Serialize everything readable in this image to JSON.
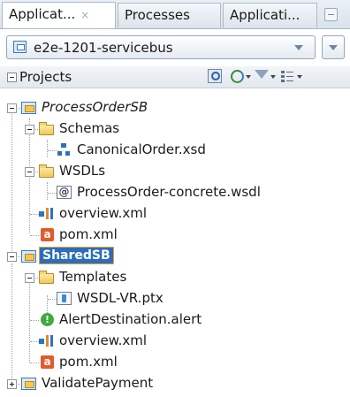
{
  "tabs": [
    {
      "label": "Applicat...",
      "close": "×",
      "active": true
    },
    {
      "label": "Processes",
      "active": false
    },
    {
      "label": "Applicati...",
      "active": false
    }
  ],
  "app_selector": {
    "value": "e2e-1201-servicebus"
  },
  "panel": {
    "title": "Projects"
  },
  "tree": {
    "process_order_sb": "ProcessOrderSB",
    "schemas": "Schemas",
    "canonical_order": "CanonicalOrder.xsd",
    "wsdls": "WSDLs",
    "process_order_wsdl": "ProcessOrder-concrete.wsdl",
    "overview_1": "overview.xml",
    "pom_1": "pom.xml",
    "shared_sb": "SharedSB",
    "templates": "Templates",
    "wsdl_vr": "WSDL-VR.ptx",
    "alert_destination": "AlertDestination.alert",
    "overview_2": "overview.xml",
    "pom_2": "pom.xml",
    "validate_payment": "ValidatePayment"
  },
  "icon_glyphs": {
    "wsdl": "@",
    "pom": "a",
    "alert": "!"
  },
  "colors": {
    "selection": "#2f6dbb",
    "folder": "#f1c85a",
    "tab_bg": "#d9e2ec"
  }
}
